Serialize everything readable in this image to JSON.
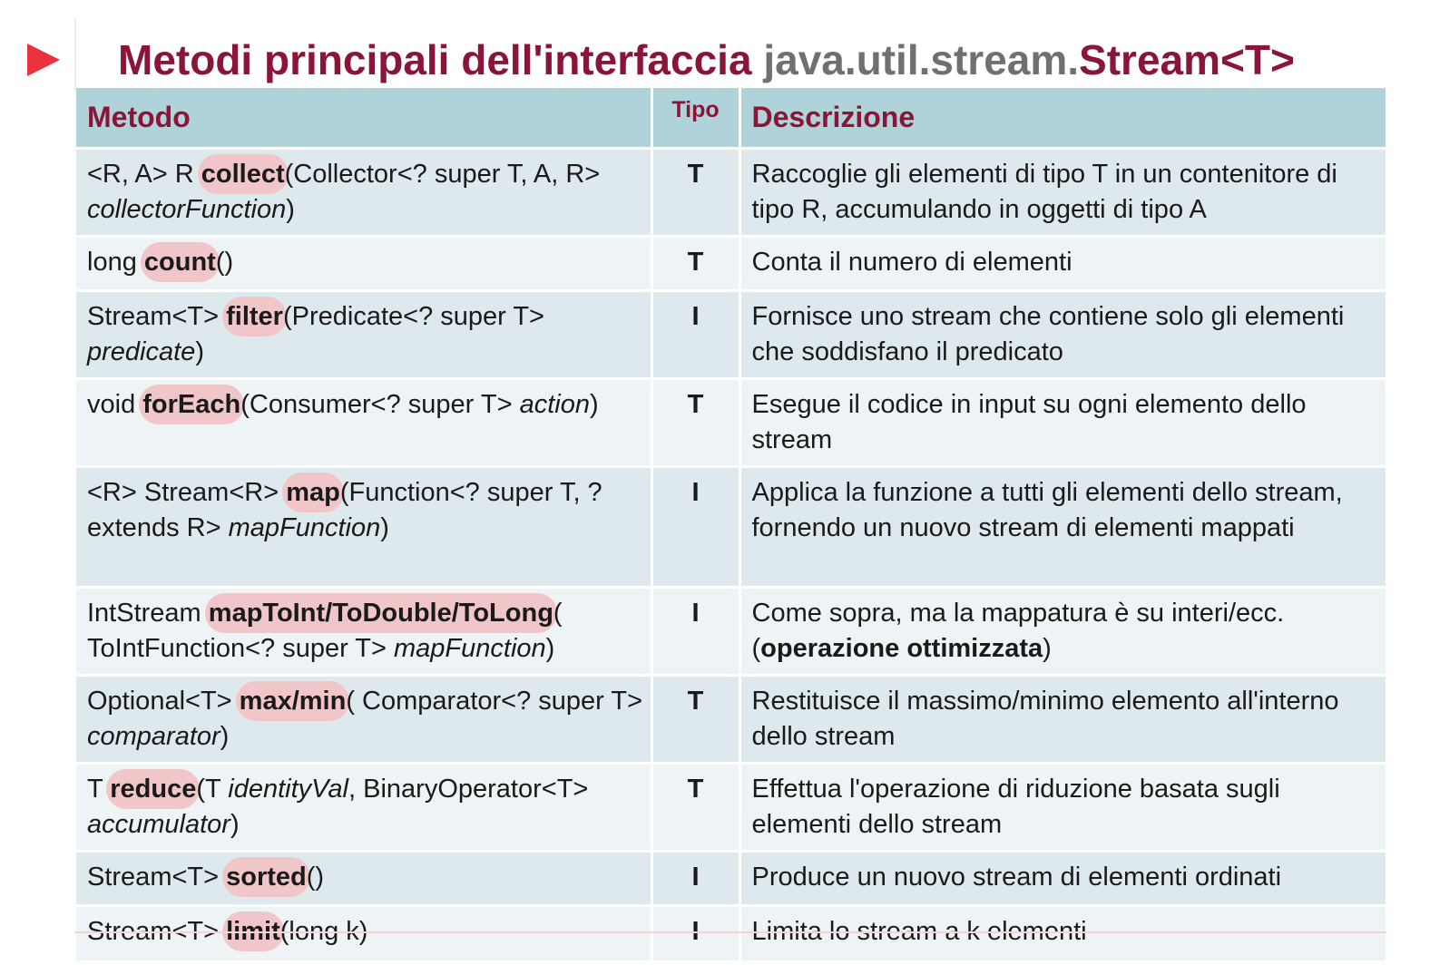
{
  "slide": {
    "title_main": "Metodi principali dell'interfaccia ",
    "title_pkg": "java.util.stream.",
    "title_type": "Stream<T>",
    "accent_color": "#8a1538",
    "play_icon_color": "#e8323c"
  },
  "table": {
    "headers": {
      "metodo": "Metodo",
      "tipo": "Tipo",
      "descrizione": "Descrizione"
    },
    "rows": [
      {
        "m_pre": "<R, A> R ",
        "m_name": "collect",
        "m_mid": "(Collector<? super T, A, R> ",
        "m_arg": "collectorFunction",
        "m_post": ")",
        "tipo": "T",
        "desc": "Raccoglie gli elementi di tipo T in un contenitore di tipo R, accumulando in oggetti di tipo A"
      },
      {
        "m_pre": "long ",
        "m_name": "count",
        "m_mid": "()",
        "m_arg": "",
        "m_post": "",
        "tipo": "T",
        "desc": "Conta il numero di elementi"
      },
      {
        "m_pre": "Stream<T> ",
        "m_name": "filter",
        "m_mid": "(Predicate<? super T> ",
        "m_arg": "predicate",
        "m_post": ")",
        "tipo": "I",
        "desc": "Fornisce uno stream che contiene solo gli elementi che soddisfano il predicato"
      },
      {
        "m_pre": "void ",
        "m_name": "forEach",
        "m_mid": "(Consumer<? super T> ",
        "m_arg": "action",
        "m_post": ")",
        "tipo": "T",
        "desc": "Esegue il codice in input su ogni elemento dello stream"
      },
      {
        "m_pre": "<R> Stream<R> ",
        "m_name": "map",
        "m_mid": "(Function<? super T, ? extends R> ",
        "m_arg": "mapFunction",
        "m_post": ")",
        "tipo": "I",
        "desc": "Applica la funzione a tutti gli elementi dello stream, fornendo un nuovo stream di elementi mappati"
      },
      {
        "m_pre": "IntStream ",
        "m_name": "mapToInt/ToDouble/ToLong",
        "m_mid": "( ToIntFunction<? super T> ",
        "m_arg": "mapFunction",
        "m_post": ")",
        "tipo": "I",
        "desc": "Come sopra, ma la mappatura è su interi/ecc. (",
        "desc_bold": "operazione ottimizzata",
        "desc_post": ")"
      },
      {
        "m_pre": "Optional<T> ",
        "m_name": "max/min",
        "m_mid": "( Comparator<? super T> ",
        "m_arg": "comparator",
        "m_post": ")",
        "tipo": "T",
        "desc": "Restituisce il massimo/minimo elemento all'interno dello stream"
      },
      {
        "m_pre": "T ",
        "m_name": "reduce",
        "m_mid": "(T ",
        "m_arg": "identityVal",
        "m_mid2": ", BinaryOperator<T> ",
        "m_arg2": "accumulator",
        "m_post": ")",
        "tipo": "T",
        "desc": "Effettua l'operazione di riduzione basata sugli elementi dello stream"
      },
      {
        "m_pre": "Stream<T> ",
        "m_name": "sorted",
        "m_mid": "()",
        "m_arg": "",
        "m_post": "",
        "tipo": "I",
        "desc": "Produce un nuovo stream di elementi ordinati"
      },
      {
        "m_pre": "Stream<T> ",
        "m_name": "limit",
        "m_mid": "(long k)",
        "m_arg": "",
        "m_post": "",
        "tipo": "I",
        "desc": "Limita lo stream a k elementi"
      }
    ]
  }
}
